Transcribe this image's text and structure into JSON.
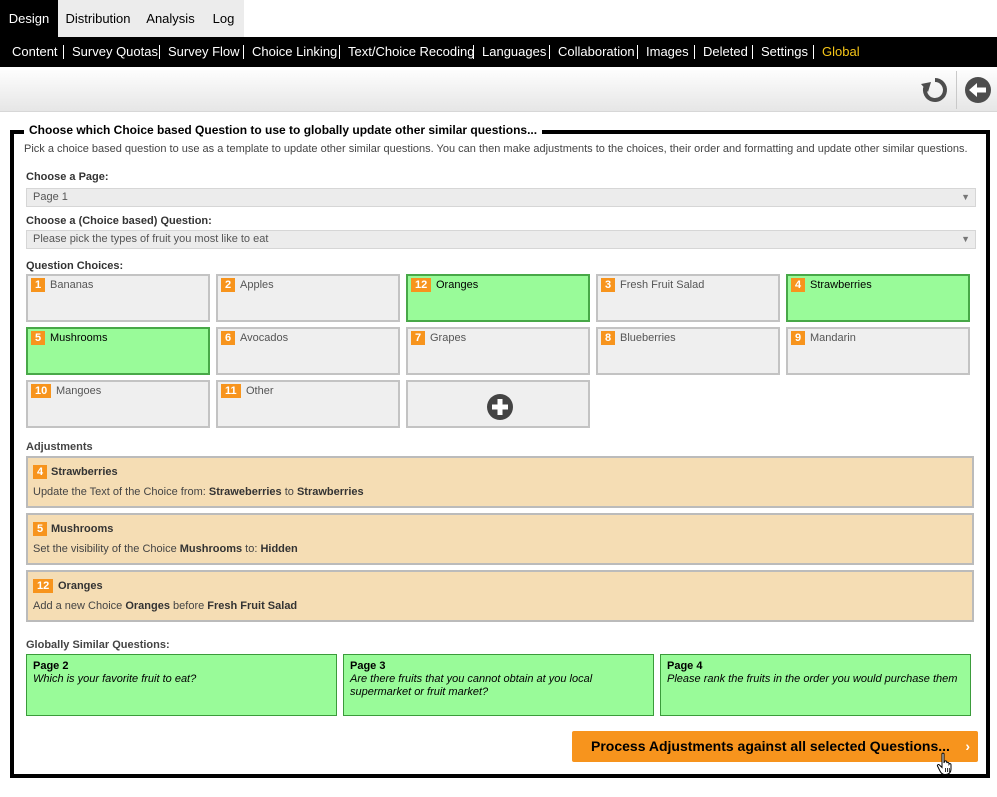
{
  "top_tabs": [
    {
      "label": "Design",
      "active": true
    },
    {
      "label": "Distribution",
      "active": false
    },
    {
      "label": "Analysis",
      "active": false
    },
    {
      "label": "Log",
      "active": false
    }
  ],
  "subnav": [
    {
      "label": "Content"
    },
    {
      "label": "Survey Quotas"
    },
    {
      "label": "Survey Flow"
    },
    {
      "label": "Choice Linking"
    },
    {
      "label": "Text/Choice Recoding"
    },
    {
      "label": "Languages"
    },
    {
      "label": "Collaboration"
    },
    {
      "label": "Images"
    },
    {
      "label": "Deleted"
    },
    {
      "label": "Settings"
    },
    {
      "label": "Global",
      "active": true
    }
  ],
  "toolbar": {
    "icons": [
      "undo-icon",
      "back-arrow-icon"
    ]
  },
  "panel": {
    "title": "Choose which Choice based Question to use to globally update other similar questions...",
    "description": "Pick a choice based question to use as a template to update other similar questions. You can then make adjustments to the choices, their order and formatting and update other similar questions."
  },
  "page_select": {
    "label": "Choose a Page:",
    "value": "Page 1"
  },
  "question_select": {
    "label": "Choose a (Choice based) Question:",
    "value": "Please pick the types of fruit you most like to eat"
  },
  "choices": {
    "label": "Question Choices:",
    "items": [
      {
        "num": "1",
        "text": "Bananas",
        "selected": false
      },
      {
        "num": "2",
        "text": "Apples",
        "selected": false
      },
      {
        "num": "12",
        "text": "Oranges",
        "selected": true
      },
      {
        "num": "3",
        "text": "Fresh Fruit Salad",
        "selected": false
      },
      {
        "num": "4",
        "text": "Strawberries",
        "selected": true
      },
      {
        "num": "5",
        "text": "Mushrooms",
        "selected": true
      },
      {
        "num": "6",
        "text": "Avocados",
        "selected": false
      },
      {
        "num": "7",
        "text": "Grapes",
        "selected": false
      },
      {
        "num": "8",
        "text": "Blueberries",
        "selected": false
      },
      {
        "num": "9",
        "text": "Mandarin",
        "selected": false
      },
      {
        "num": "10",
        "text": "Mangoes",
        "selected": false
      },
      {
        "num": "11",
        "text": "Other",
        "selected": false
      }
    ]
  },
  "adjustments": {
    "label": "Adjustments",
    "items": [
      {
        "num": "4",
        "name": "Strawberries",
        "prefix": "Update the Text of the Choice from: ",
        "b1": "Straweberries",
        "mid": " to ",
        "b2": "Strawberries"
      },
      {
        "num": "5",
        "name": "Mushrooms",
        "prefix": "Set the visibility of the Choice ",
        "b1": "Mushrooms",
        "mid": " to: ",
        "b2": "Hidden"
      },
      {
        "num": "12",
        "name": "Oranges",
        "prefix": "Add a new Choice ",
        "b1": "Oranges",
        "mid": " before ",
        "b2": "Fresh Fruit Salad"
      }
    ]
  },
  "similar": {
    "label": "Globally Similar Questions:",
    "items": [
      {
        "page": "Page 2",
        "question": "Which is your favorite fruit to eat?"
      },
      {
        "page": "Page 3",
        "question": "Are there fruits that you cannot obtain at you local supermarket or fruit market?"
      },
      {
        "page": "Page 4",
        "question": "Please rank the fruits in the order you would purchase them"
      }
    ]
  },
  "process_button": {
    "label": "Process Adjustments against all selected Questions...",
    "chevron": "›"
  },
  "colors": {
    "accent": "#f7941d",
    "selected": "#99fb99",
    "adjustment": "#f5ddb4",
    "active_nav": "#f5c518"
  }
}
